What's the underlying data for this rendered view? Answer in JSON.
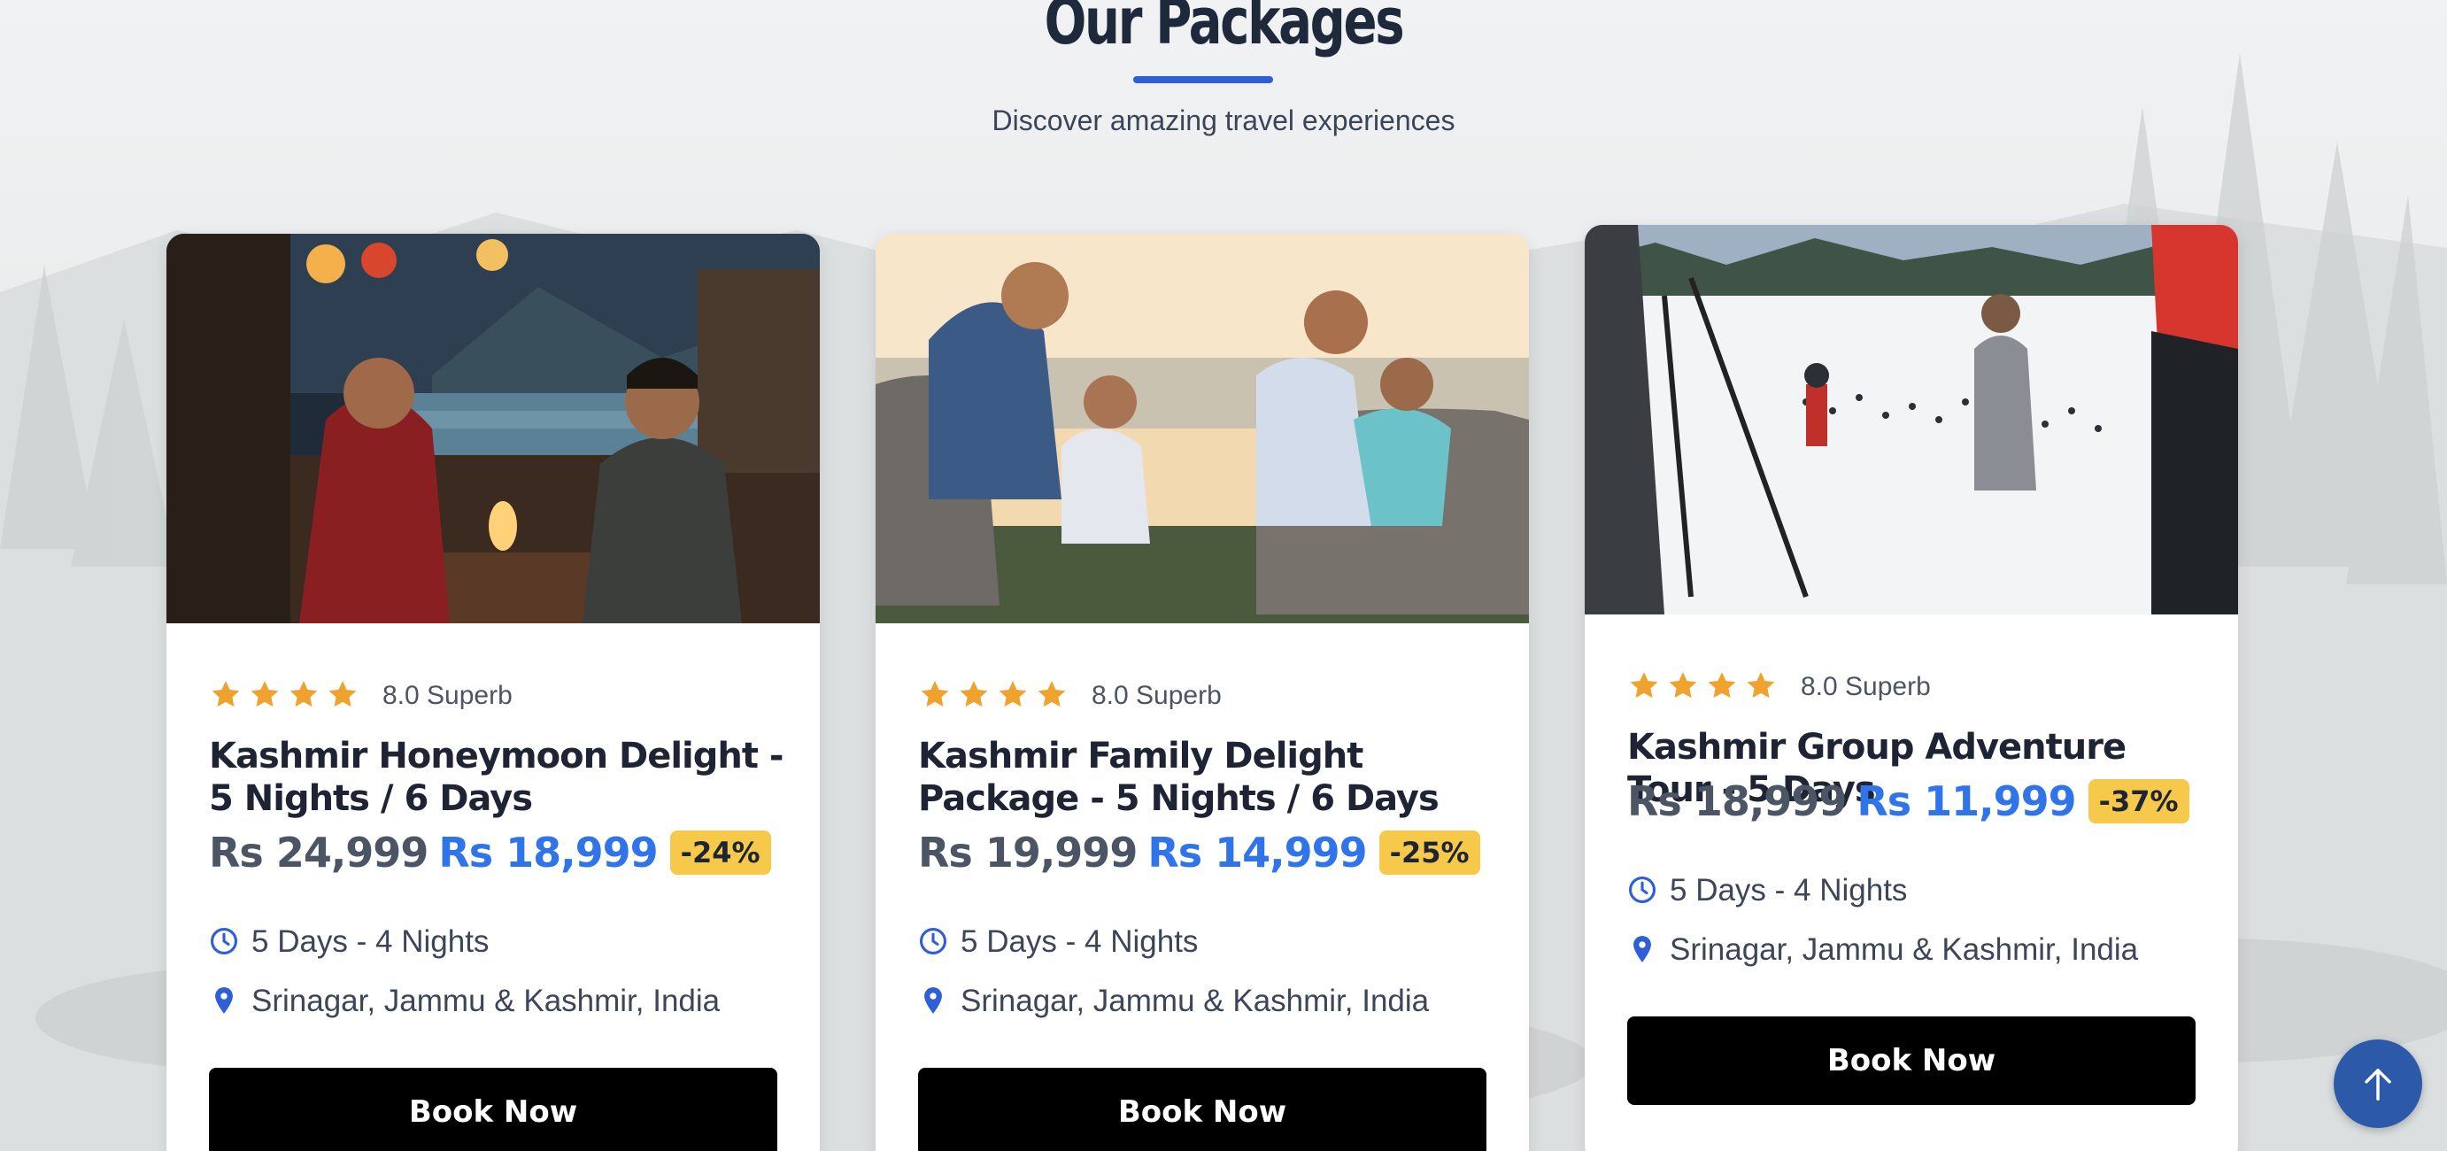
{
  "section": {
    "title": "Our Packages",
    "subtitle": "Discover amazing travel experiences"
  },
  "colors": {
    "accent_blue": "#2f74e8",
    "underline_blue": "#2f5fd6",
    "star_orange": "#f0a22e",
    "discount_yellow": "#f7c94a",
    "button_black": "#000000",
    "scroll_top_blue": "#2c5aa8"
  },
  "packages": [
    {
      "photo": "couple-candlelight-dinner-riverside",
      "stars": 4,
      "rating": "8.0 Superb",
      "title": "Kashmir Honeymoon Delight - 5 Nights / 6 Days",
      "price_old": "Rs 24,999",
      "price_new": "Rs 18,999",
      "discount": "-24%",
      "duration": "5 Days - 4 Nights",
      "location": "Srinagar, Jammu & Kashmir, India",
      "cta": "Book Now"
    },
    {
      "photo": "family-on-boat-sunset",
      "stars": 4,
      "rating": "8.0 Superb",
      "title": "Kashmir Family Delight Package - 5 Nights / 6 Days",
      "price_old": "Rs 19,999",
      "price_new": "Rs 14,999",
      "discount": "-25%",
      "duration": "5 Days - 4 Nights",
      "location": "Srinagar, Jammu & Kashmir, India",
      "cta": "Book Now"
    },
    {
      "photo": "skiers-on-snow-slope",
      "stars": 4,
      "rating": "8.0 Superb",
      "title": "Kashmir Group Adventure Tour - 5 Days",
      "price_old": "Rs 18,999",
      "price_new": "Rs 11,999",
      "discount": "-37%",
      "duration": "5 Days - 4 Nights",
      "location": "Srinagar, Jammu & Kashmir, India",
      "cta": "Book Now"
    }
  ],
  "icons": {
    "star": "star-icon",
    "clock": "clock-icon",
    "location": "map-pin-icon",
    "scroll_top": "arrow-up-icon"
  }
}
